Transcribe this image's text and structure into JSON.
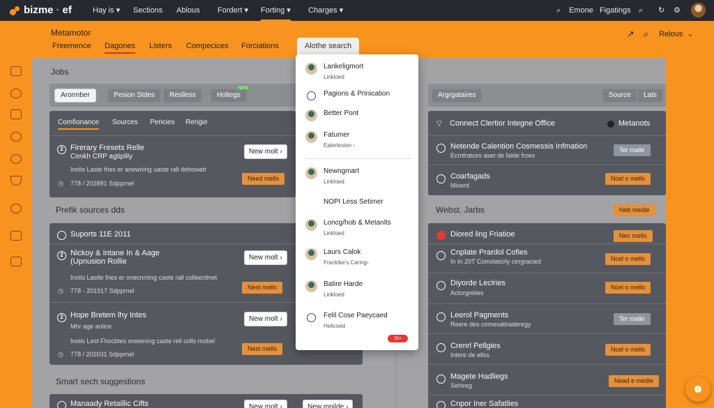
{
  "brand": {
    "name": "bizme",
    "dot": "·",
    "suffix": "ef"
  },
  "nav": [
    "Hay is",
    "Sections",
    "Ablous",
    "Fordert",
    "Forting",
    "Charges"
  ],
  "nav_dropdowns": [
    true,
    false,
    false,
    true,
    true,
    true
  ],
  "topright": {
    "label1": "Emone",
    "label2": "Figatings"
  },
  "page": {
    "title": "Metamotor",
    "tabs": [
      "Freemence",
      "Dagones",
      "Listers",
      "Compecices",
      "Forciations"
    ],
    "search_tab": "Alothe search",
    "relous": "Relous"
  },
  "sections": {
    "jobs": "Jobs",
    "prefik": "Prefik sources dds",
    "smart": "Smart sech suggestions",
    "webst": "Webst. Jarbs"
  },
  "jobs_chips": [
    "Arormber",
    "Pesion Stdes",
    "Reslless",
    "Holtegs"
  ],
  "jobs_chip_badge": "NEW",
  "right_chips": {
    "left": "Argrgataires",
    "source": "Source",
    "lats": "Lats"
  },
  "panel1": {
    "tabs": [
      "Comfionance",
      "Sources",
      "Pericies",
      "Rerigie"
    ],
    "item": {
      "number": "2",
      "title": "Firerary Fresets Relle",
      "title2": "Cenkh CRP agtiplity",
      "desc": "Inolis Laste fries er anewning uaste rall dehowatt",
      "meta": "778 / 202891 Sdpprnel",
      "btn_new": "New molt ›",
      "btn_need": "Need mells"
    }
  },
  "panel2": {
    "header": "Suports 11E 2011",
    "items": [
      {
        "number": "2",
        "title": "Nickoy & Intane In & Aage",
        "title2": "(Upnusion Rollie",
        "desc": "Inolis Lastle fries er onecnming caste rall colleectinet",
        "meta": "778 - 201917 Sdpprnel",
        "btn_new": "New molt ›",
        "btn_need": "Nest mells"
      },
      {
        "number": "2",
        "title": "Hope Bretem lhy Intes",
        "title2": "Mhr age anlice",
        "desc": "Inolis Lest Fhocbtes onewning caste rell colls mobel",
        "meta": "778 / 202031 Sdpprnel",
        "btn_new": "New molt ›",
        "btn_need": "Nest mells"
      }
    ]
  },
  "panel_bottom": {
    "title": "Manaady Retaillic Cifts",
    "btn1": "New molt ›",
    "btn2": "New mnilde ›"
  },
  "right1": {
    "header": {
      "title": "Connect Clertior Integne Office",
      "right": "Metanots"
    },
    "items": [
      {
        "title": "Netende Calention Cosmessis Infmation",
        "sub": "Ecmfratces aset de falde froes",
        "btn": "Ter malle"
      },
      {
        "title": "Coarfagads",
        "sub": "Mixerd",
        "btn": "Ncel o mells"
      }
    ]
  },
  "webst_btn": "Neb medle",
  "right2": {
    "items": [
      {
        "title": "Diored ling Friatioe",
        "sub": "",
        "btn": "Nec mells"
      },
      {
        "title": "Cnplate Prardol Cofies",
        "sub": "In In 20T Comolatcrly cergracied",
        "btn": "Ncel o mells"
      },
      {
        "title": "Diyorde Leclries",
        "sub": "Actorgrelies",
        "btn": "Ncel o mells"
      },
      {
        "title": "Leerol Pagments",
        "sub": "Reere des comesatiraderegy",
        "btn": "Ter malle"
      },
      {
        "title": "Crenrl Pellgies",
        "sub": "Intere de ellss",
        "btn": "Ncel o mells"
      },
      {
        "title": "Magete Hadliegs",
        "sub": "Sehireg",
        "btn": "Nead e medle"
      },
      {
        "title": "Cnpor Iner Safatlies",
        "sub": "",
        "btn": ""
      }
    ]
  },
  "dropdown": {
    "items": [
      {
        "title": "Lankeligmort",
        "sub": "Linkloed",
        "icon": "person-avatar-icon"
      },
      {
        "title": "Pagions & Prinication",
        "sub": "",
        "icon": "globe-icon"
      },
      {
        "title": "Better Pont",
        "sub": "",
        "icon": "person-avatar-icon"
      },
      {
        "title": "Fatumer",
        "sub": "Eaterlesion ›",
        "icon": "person-avatar-icon"
      },
      {
        "title": "Newngmart",
        "sub": "Linkloed",
        "icon": "person-avatar-icon"
      },
      {
        "title": "NOPI Less Setimer",
        "sub": "",
        "icon": ""
      },
      {
        "title": "Loncg/hob & Metanlts",
        "sub": "Linkloed",
        "icon": "person-avatar-icon"
      },
      {
        "title": "Laurs Calok",
        "sub": "Fracktke's Caring›",
        "icon": "person-avatar-icon"
      },
      {
        "title": "Batire Harde",
        "sub": "Linkloed",
        "icon": "person-avatar-icon"
      },
      {
        "title": "Felil Cose Paeycaed",
        "sub": "Helicoed",
        "icon": "info-icon"
      }
    ],
    "pill": "Do"
  },
  "colors": {
    "accent": "#f7931e",
    "topbar": "#26292f",
    "panel": "#55585f",
    "cta": "#e5913c"
  }
}
